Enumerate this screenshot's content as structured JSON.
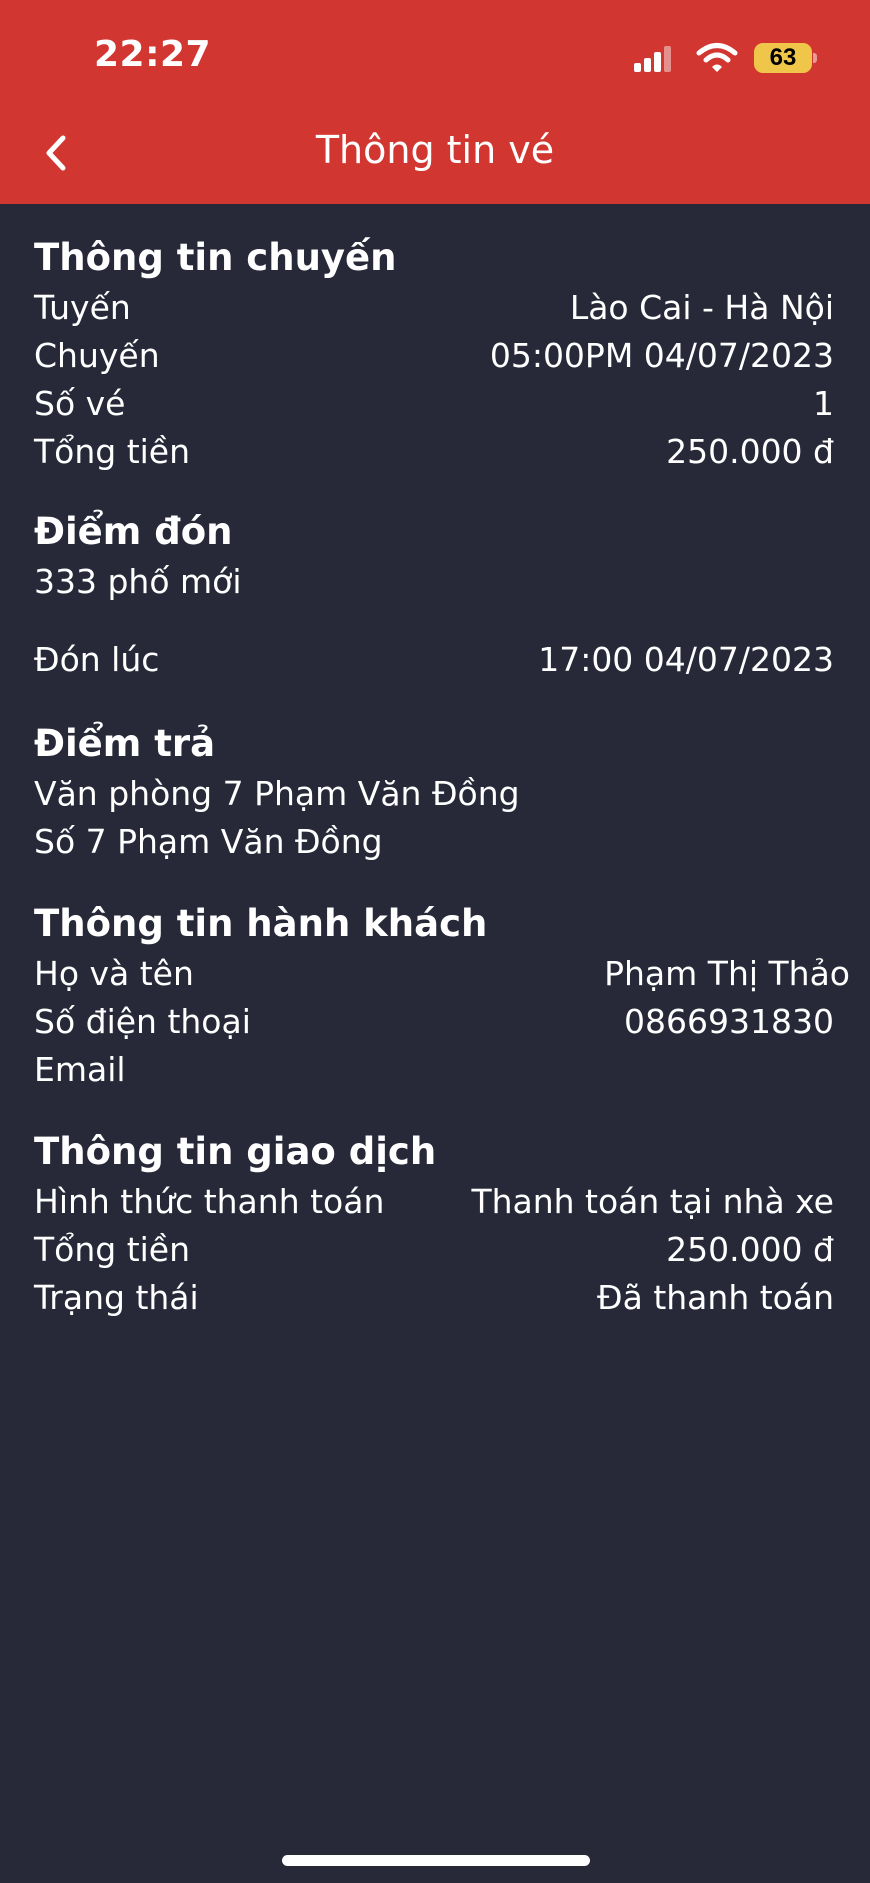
{
  "status_bar": {
    "time": "22:27",
    "battery": "63",
    "icons": [
      "signal-icon",
      "wifi-icon",
      "battery-icon"
    ]
  },
  "header": {
    "title": "Thông tin vé",
    "back_icon": "chevron-left-icon",
    "background_color": "#d23631"
  },
  "theme": {
    "background": "#272939",
    "text": "#ffffff"
  },
  "trip": {
    "title": "Thông tin chuyến",
    "rows": [
      {
        "label": "Tuyến",
        "value": "Lào Cai - Hà Nội"
      },
      {
        "label": "Chuyến",
        "value": "05:00PM 04/07/2023"
      },
      {
        "label": "Số vé",
        "value": "1"
      },
      {
        "label": "Tổng tiền",
        "value": "250.000 đ"
      }
    ]
  },
  "pickup": {
    "title": "Điểm đón",
    "address": "333 phố mới",
    "time_label": "Đón lúc",
    "time_value": "17:00 04/07/2023"
  },
  "dropoff": {
    "title": "Điểm trả",
    "name": "Văn phòng 7 Phạm Văn Đồng",
    "address": "Số 7 Phạm Văn Đồng"
  },
  "passenger": {
    "title": "Thông tin hành khách",
    "rows": [
      {
        "label": "Họ và tên",
        "value": "Phạm Thị Thảo"
      },
      {
        "label": "Số điện thoại",
        "value": "0866931830"
      },
      {
        "label": "Email",
        "value": ""
      }
    ]
  },
  "transaction": {
    "title": "Thông tin giao dịch",
    "rows": [
      {
        "label": "Hình thức thanh toán",
        "value": "Thanh toán tại nhà xe"
      },
      {
        "label": "Tổng tiền",
        "value": "250.000 đ"
      },
      {
        "label": "Trạng thái",
        "value": "Đã thanh toán"
      }
    ]
  }
}
